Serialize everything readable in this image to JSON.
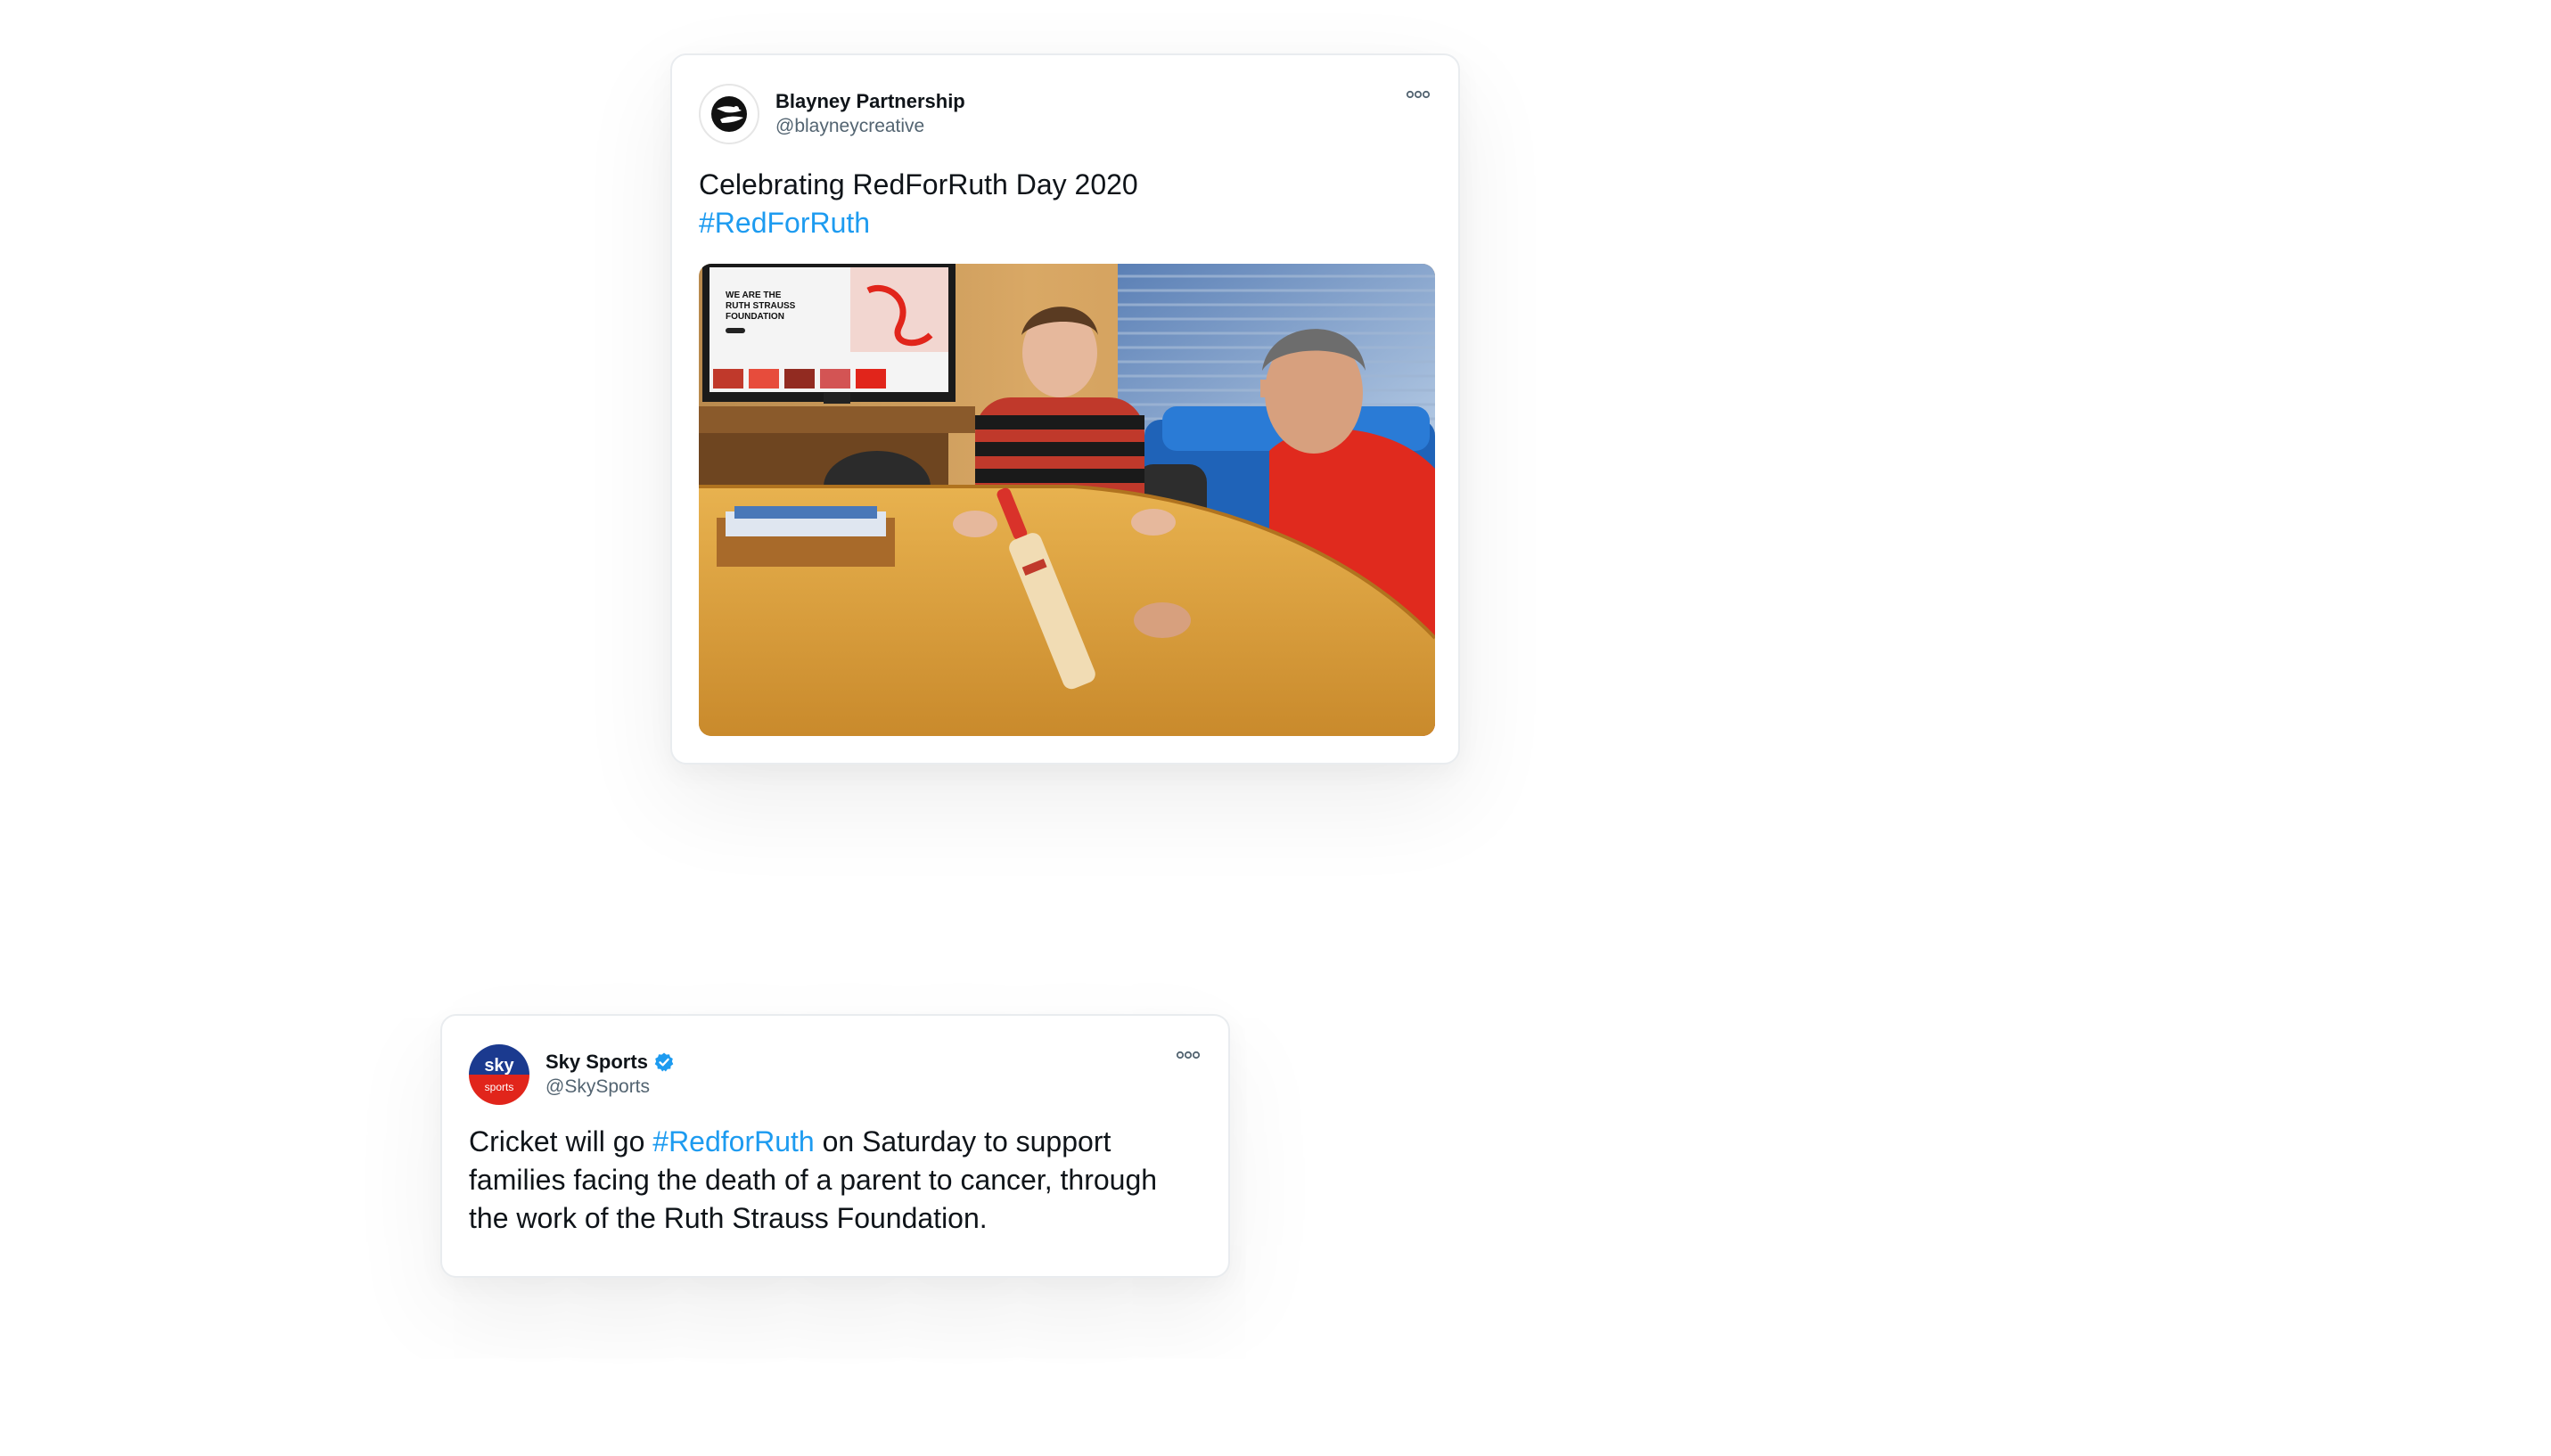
{
  "tweets": [
    {
      "display_name": "Blayney Partnership",
      "handle": "@blayneycreative",
      "verified": false,
      "text_line1": "Celebrating RedForRuth Day 2020",
      "hashtag": "#RedForRuth",
      "has_photo": true,
      "photo_screen_text": {
        "headline_line1": "WE ARE THE",
        "headline_line2": "RUTH STRAUSS",
        "headline_line3": "FOUNDATION"
      }
    },
    {
      "display_name": "Sky Sports",
      "handle": "@SkySports",
      "verified": true,
      "text_before": "Cricket will go ",
      "hashtag": "#RedforRuth",
      "text_after": " on Saturday to support families facing the death of a parent to cancer, through the work of the Ruth Strauss Foundation.",
      "avatar_text_top": "sky",
      "avatar_text_bottom": "sports"
    }
  ],
  "colors": {
    "hashtag": "#1d9bf0",
    "verified": "#1d9bf0",
    "text": "#0f1419",
    "handle": "#536471",
    "sky_blue": "#1b3a8f",
    "sky_red": "#e1251b"
  }
}
